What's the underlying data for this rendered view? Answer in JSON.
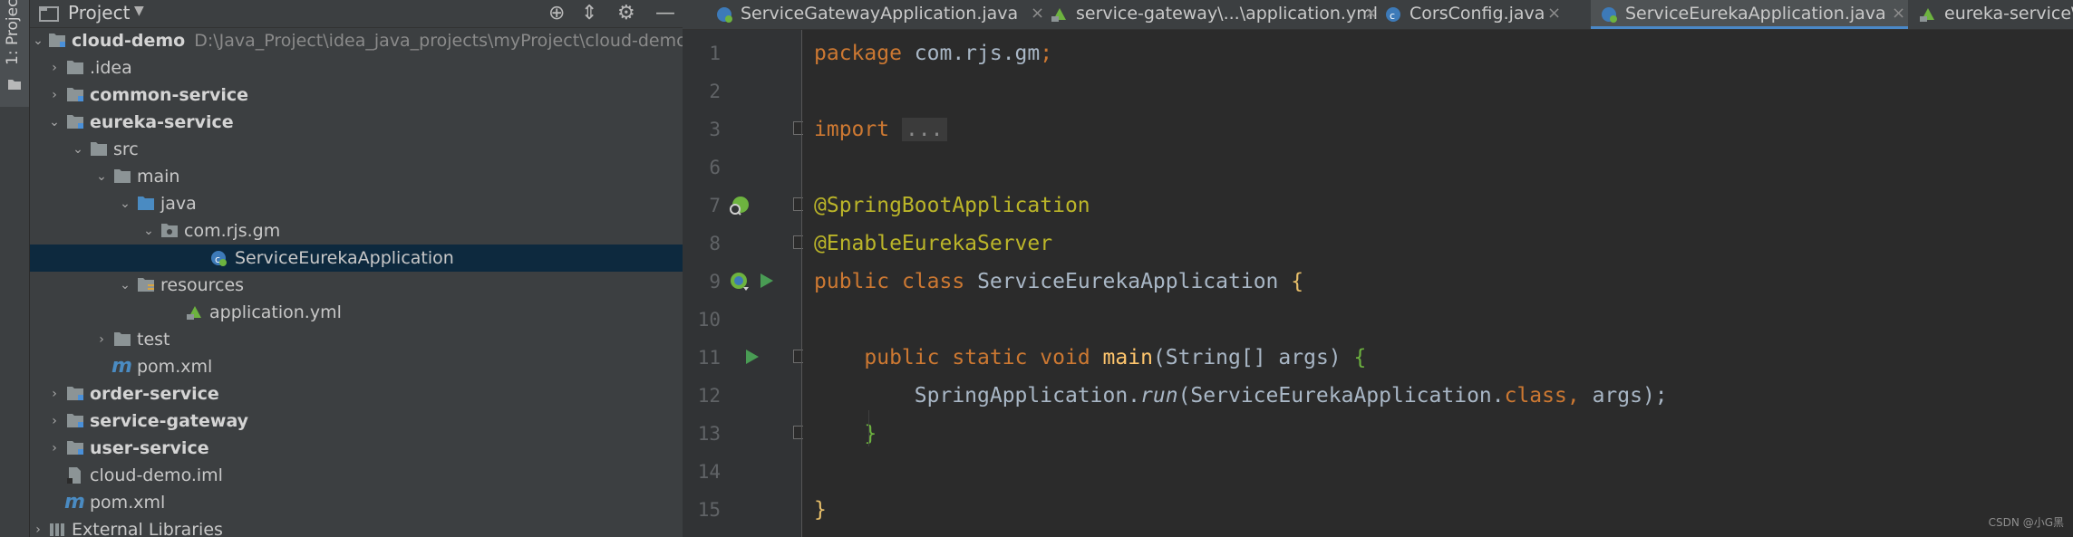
{
  "sidebar_strip": {
    "label": "1: Project"
  },
  "project_panel": {
    "title": "Project",
    "tree": [
      {
        "label": "cloud-demo",
        "path": "D:\\Java_Project\\idea_java_projects\\myProject\\cloud-demo",
        "type": "module",
        "expanded": true,
        "bold": true
      },
      {
        "label": ".idea",
        "type": "folder",
        "expanded": false
      },
      {
        "label": "common-service",
        "type": "module",
        "expanded": false,
        "bold": true
      },
      {
        "label": "eureka-service",
        "type": "module",
        "expanded": true,
        "bold": true
      },
      {
        "label": "src",
        "type": "folder",
        "expanded": true
      },
      {
        "label": "main",
        "type": "folder",
        "expanded": true
      },
      {
        "label": "java",
        "type": "source-folder",
        "expanded": true
      },
      {
        "label": "com.rjs.gm",
        "type": "package",
        "expanded": true
      },
      {
        "label": "ServiceEurekaApplication",
        "type": "spring-class",
        "selected": true
      },
      {
        "label": "resources",
        "type": "resources-folder",
        "expanded": true
      },
      {
        "label": "application.yml",
        "type": "yml"
      },
      {
        "label": "test",
        "type": "folder",
        "expanded": false
      },
      {
        "label": "pom.xml",
        "type": "maven"
      },
      {
        "label": "order-service",
        "type": "module",
        "expanded": false,
        "bold": true
      },
      {
        "label": "service-gateway",
        "type": "module",
        "expanded": false,
        "bold": true
      },
      {
        "label": "user-service",
        "type": "module",
        "expanded": false,
        "bold": true
      },
      {
        "label": "cloud-demo.iml",
        "type": "iml"
      },
      {
        "label": "pom.xml",
        "type": "maven"
      },
      {
        "label": "External Libraries",
        "type": "libraries",
        "expanded": false
      }
    ]
  },
  "editor": {
    "tabs": [
      {
        "label": "ServiceGatewayApplication.java",
        "icon": "spring-class-icon",
        "active": false
      },
      {
        "label": "service-gateway\\...\\application.yml",
        "icon": "yml-icon",
        "active": false
      },
      {
        "label": "CorsConfig.java",
        "icon": "class-icon",
        "active": false
      },
      {
        "label": "ServiceEurekaApplication.java",
        "icon": "spring-class-icon",
        "active": true
      },
      {
        "label": "eureka-service\\",
        "icon": "yml-icon",
        "active": false
      }
    ],
    "line_numbers": [
      "1",
      "2",
      "3",
      "6",
      "7",
      "8",
      "9",
      "10",
      "11",
      "12",
      "13",
      "14",
      "15"
    ],
    "code": {
      "l1": {
        "kw": "package",
        "rest": " com.rjs.gm",
        "semi": ";"
      },
      "l3": {
        "kw": "import",
        "folded": "..."
      },
      "l7": "@SpringBootApplication",
      "l8": "@EnableEurekaServer",
      "l9": {
        "kw1": "public",
        "kw2": "class",
        "name": "ServiceEurekaApplication",
        "brace": "{"
      },
      "l11": {
        "kw1": "public",
        "kw2": "static",
        "kw3": "void",
        "method": "main",
        "params": "(String[] args)",
        "brace": "{"
      },
      "l12": {
        "target": "SpringApplication.",
        "call": "run",
        "arg_open": "(ServiceEurekaApplication.",
        "kwclass": "class",
        "comma": ",",
        "arg_rest": " args);"
      },
      "l13": "}",
      "l15": "}"
    },
    "watermark": "CSDN @小G黑"
  },
  "colors": {
    "keyword": "#cc7832",
    "annotation": "#bbb529",
    "method": "#ffc66d",
    "text": "#a9b7c6",
    "selection": "#0d293e",
    "active_tab_underline": "#4a88c7"
  }
}
